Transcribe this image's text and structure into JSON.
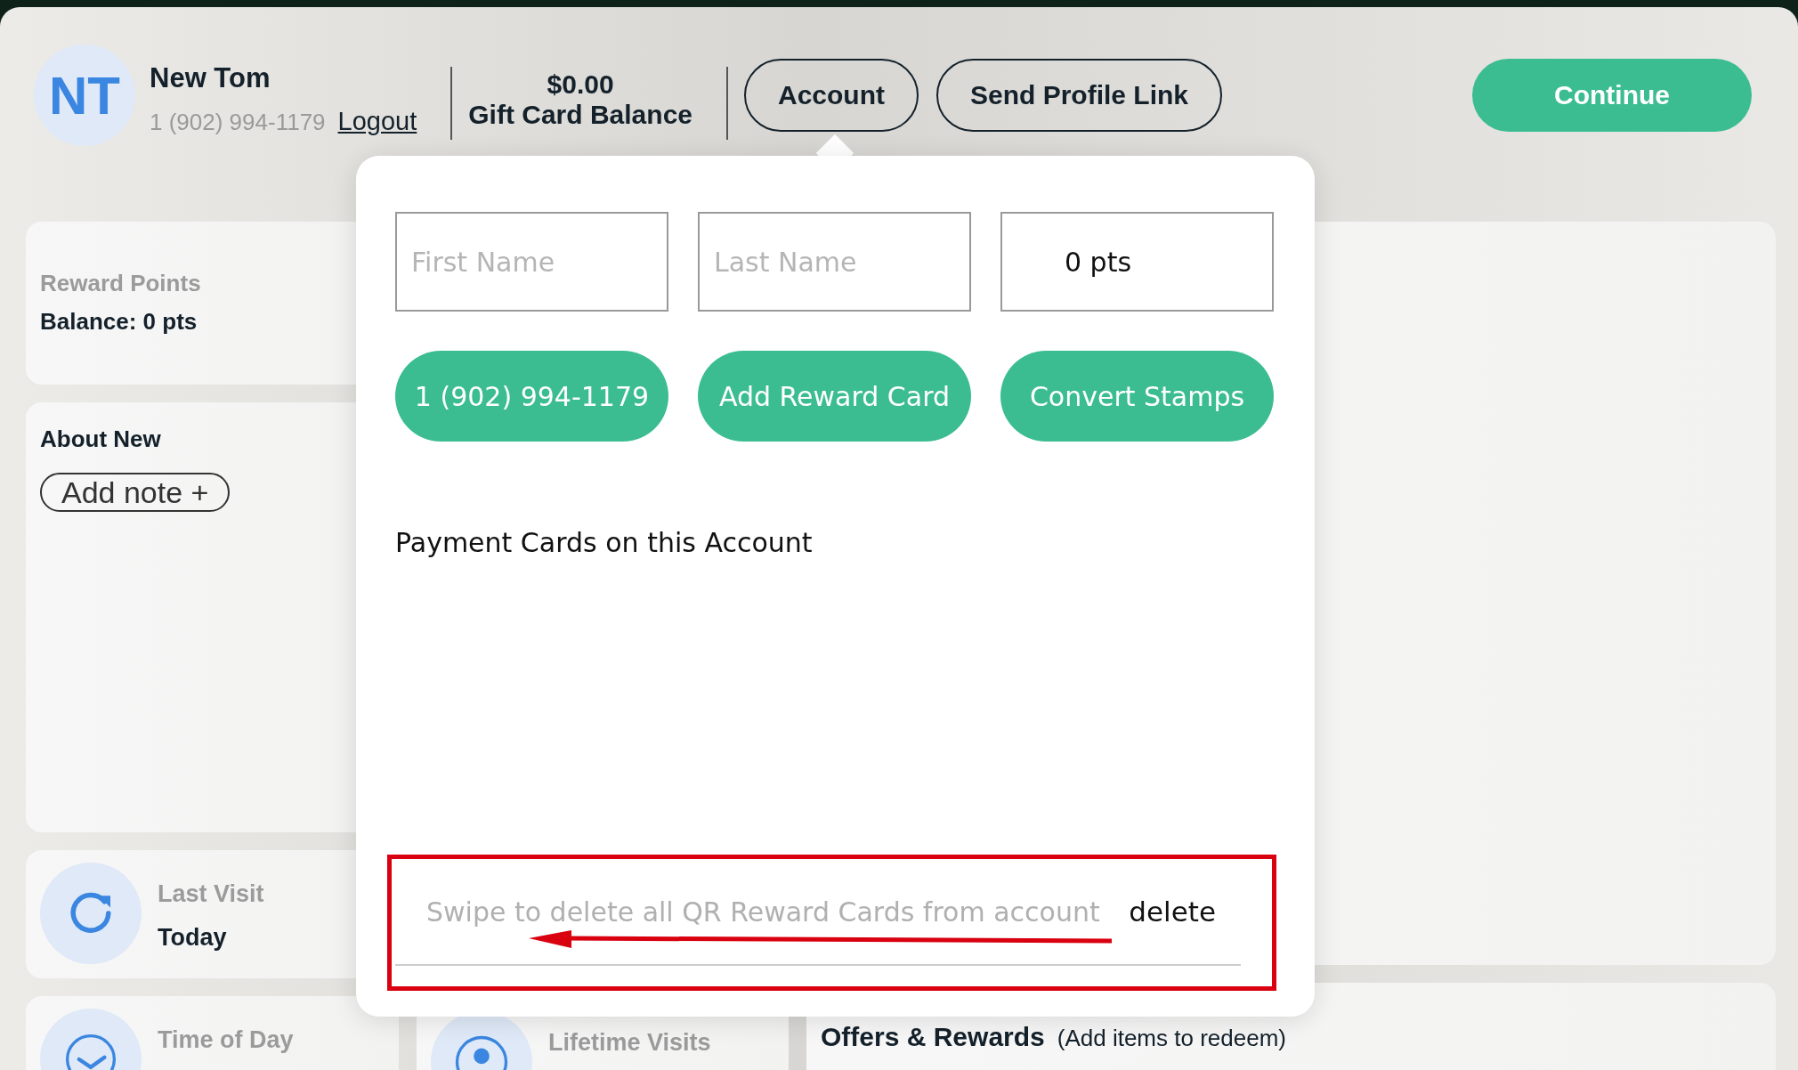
{
  "customer": {
    "initials": "NT",
    "name": "New Tom",
    "phone": "1 (902) 994-1179",
    "logout": "Logout"
  },
  "gift_card": {
    "amount": "$0.00",
    "label": "Gift Card Balance"
  },
  "header_buttons": [
    {
      "label": "Account",
      "kind": "outline"
    },
    {
      "label": "Send Profile Link",
      "kind": "outline"
    },
    {
      "label": "Continue",
      "kind": "primary"
    }
  ],
  "reward_points": {
    "title": "Reward Points",
    "balance": "Balance: 0 pts"
  },
  "about": {
    "title": "About New",
    "add_note": "Add note +"
  },
  "stats": [
    {
      "label": "Last Visit",
      "value": "Today"
    },
    {
      "label": "Time of Day"
    },
    {
      "label": "Lifetime Visits"
    }
  ],
  "offers": {
    "title": "Offers & Rewards",
    "hint": "(Add items to redeem)"
  },
  "account_popover": {
    "fields": [
      {
        "placeholder": "First Name"
      },
      {
        "placeholder": "Last Name"
      },
      {
        "value": "0 pts"
      }
    ],
    "buttons": [
      "1 (902) 994-1179",
      "Add Reward Card",
      "Convert Stamps"
    ],
    "payment_cards_heading": "Payment Cards on this Account",
    "swipe_row": {
      "text": "Swipe to delete all QR Reward Cards from account",
      "action": "delete"
    }
  }
}
